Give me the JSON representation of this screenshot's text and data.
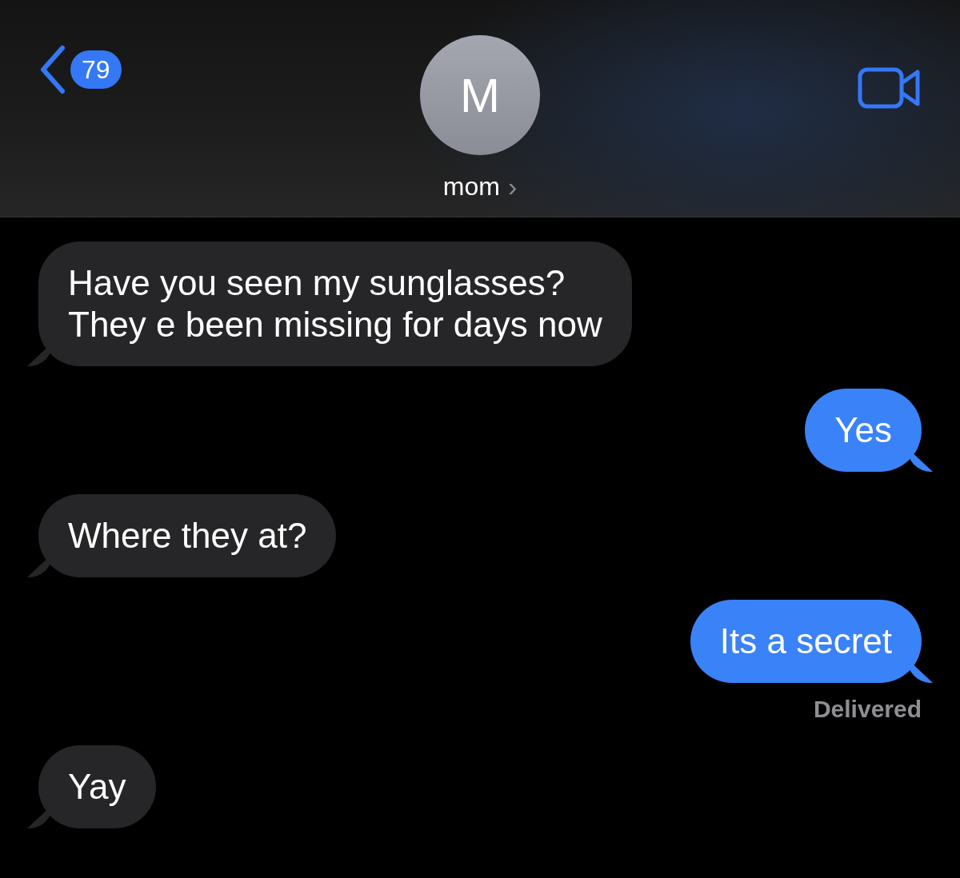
{
  "header": {
    "back_count": "79",
    "avatar_initial": "M",
    "contact_name": "mom",
    "chevron": "›"
  },
  "messages": [
    {
      "kind": "received",
      "text": "Have you seen my sunglasses?\nThey e been missing for days now"
    },
    {
      "kind": "sent",
      "text": "Yes"
    },
    {
      "kind": "received",
      "text": "Where they at?"
    },
    {
      "kind": "sent",
      "text": "Its a secret",
      "status": "Delivered"
    },
    {
      "kind": "received",
      "text": "Yay"
    }
  ]
}
